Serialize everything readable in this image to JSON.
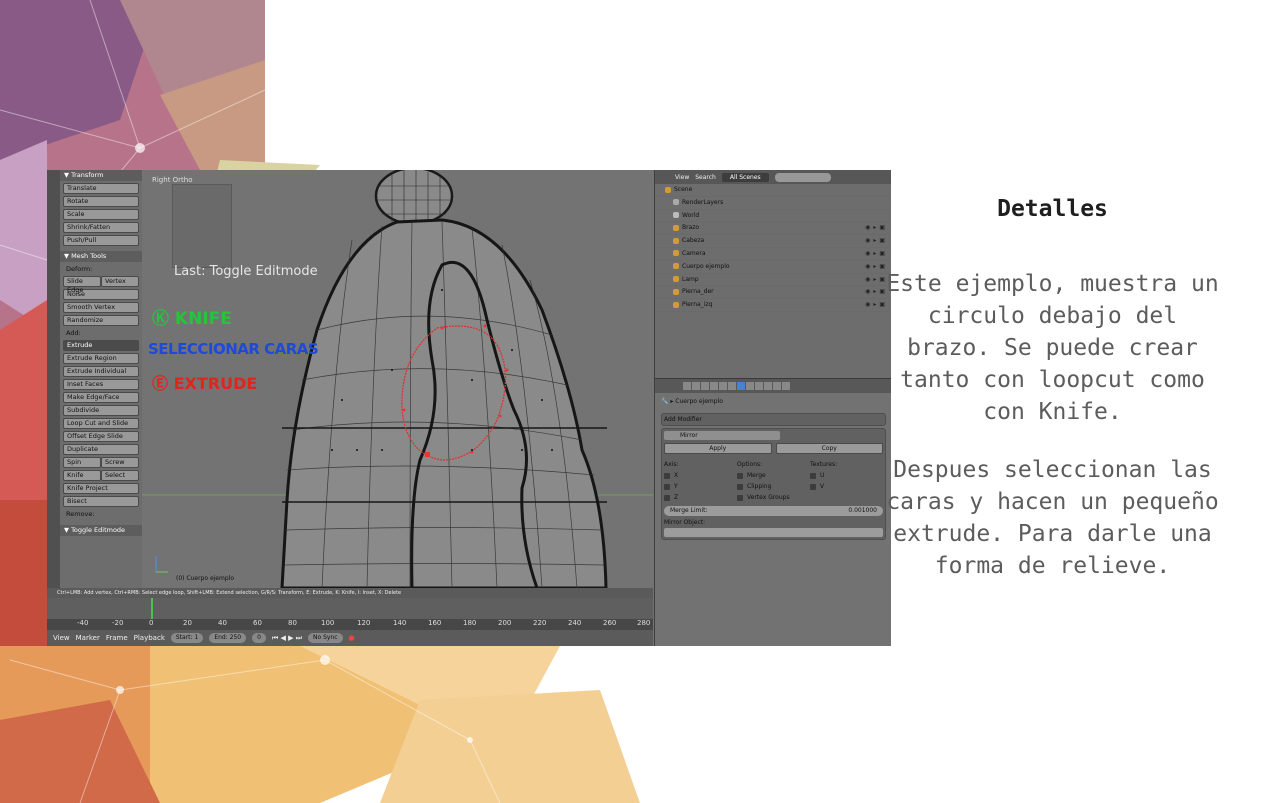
{
  "slide": {
    "heading": "Detalles",
    "paragraph1": "Este ejemplo, muestra un circulo debajo del brazo. Se puede crear tanto con loopcut como con Knife.",
    "paragraph2": "Despues seleccionan las caras y hacen un pequeño extrude. Para darle una forma de relieve."
  },
  "blender": {
    "tool_shelf": {
      "transform_header": "▼ Transform",
      "transform_items": [
        "Translate",
        "Rotate",
        "Scale",
        "Shrink/Fatten",
        "Push/Pull"
      ],
      "mesh_tools_header": "▼ Mesh Tools",
      "deform_label": "Deform:",
      "slide_edge": "Slide Edge",
      "vertex": "Vertex",
      "deform_items": [
        "Noise",
        "Smooth Vertex",
        "Randomize"
      ],
      "add_label": "Add:",
      "extrude_selected": "Extrude",
      "add_items": [
        "Extrude Region",
        "Extrude Individual",
        "Inset Faces",
        "Make Edge/Face",
        "Subdivide",
        "Loop Cut and Slide",
        "Offset Edge Slide",
        "Duplicate"
      ],
      "spin": "Spin",
      "screw": "Screw",
      "knife": "Knife",
      "select": "Select",
      "knife_project": "Knife Project",
      "bisect": "Bisect",
      "remove_label": "Remove:",
      "toggle_editmode": "▼ Toggle Editmode"
    },
    "viewport": {
      "view_title": "Right Ortho",
      "last_operator": "Last: Toggle Editmode",
      "object_label": "(0) Cuerpo ejemplo",
      "hand_knife": "Ⓚ KNIFE",
      "hand_select": "SELECCIONAR CARAS",
      "hand_extrude": "Ⓔ EXTRUDE"
    },
    "status_bar": "Ctrl+LMB: Add vertex, Ctrl+RMB: Select edge loop, Shift+LMB: Extend selection, G/R/S: Transform, E: Extrude, K: Knife, I: Inset, X: Delete",
    "timeline": {
      "ticks": [
        "-40",
        "-20",
        "0",
        "20",
        "40",
        "60",
        "80",
        "100",
        "120",
        "140",
        "160",
        "180",
        "200",
        "220",
        "240",
        "260",
        "280"
      ],
      "menu": [
        "View",
        "Marker",
        "Frame",
        "Playback"
      ],
      "start": "Start:",
      "start_value": "1",
      "end": "End:",
      "end_value": "250",
      "current": "0",
      "sync": "No Sync"
    },
    "outliner": {
      "menu": [
        "View",
        "Search"
      ],
      "scene_select": "All Scenes",
      "rows": [
        "Scene",
        "RenderLayers",
        "World",
        "Brazo",
        "Cabeza",
        "Camera",
        "Cuerpo ejemplo",
        "Lamp",
        "Pierna_der",
        "Pierna_izq"
      ]
    },
    "properties": {
      "object_name": "Cuerpo ejemplo",
      "add_modifier": "Add Modifier",
      "modifier_name": "Mirror",
      "apply": "Apply",
      "copy": "Copy",
      "axis_label": "Axis:",
      "options_label": "Options:",
      "textures_label": "Textures:",
      "axes": [
        "X",
        "Y",
        "Z"
      ],
      "options": [
        "Merge",
        "Clipping",
        "Vertex Groups"
      ],
      "textures": [
        "U",
        "V"
      ],
      "merge_limit_label": "Merge Limit:",
      "merge_limit_value": "0.001000",
      "mirror_object": "Mirror Object:"
    }
  }
}
